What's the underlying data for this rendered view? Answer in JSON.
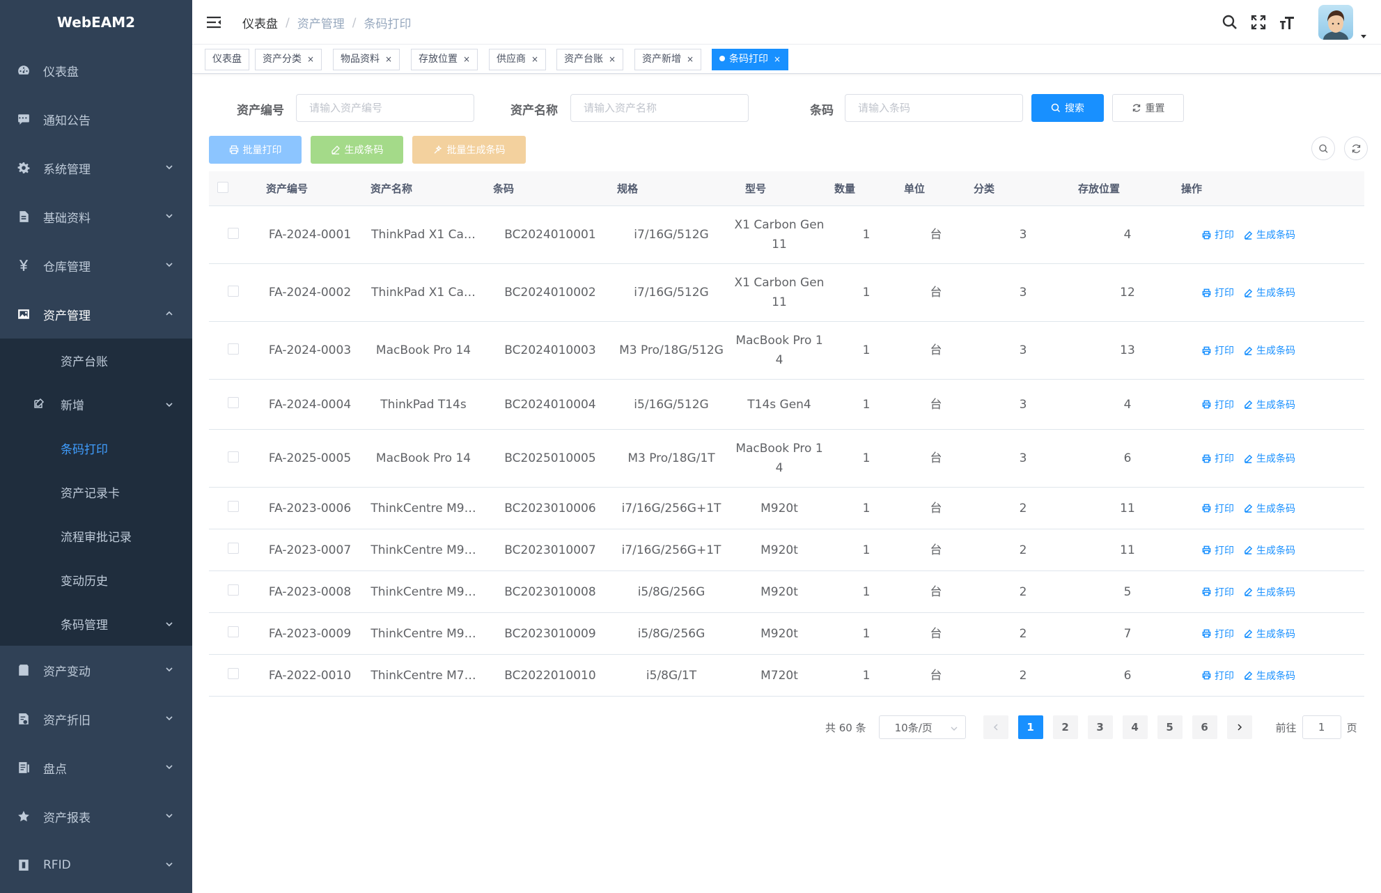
{
  "app": {
    "title": "WebEAM2"
  },
  "sidebar": {
    "items": [
      {
        "label": "仪表盘",
        "icon": "dashboard-icon"
      },
      {
        "label": "通知公告",
        "icon": "message-icon"
      },
      {
        "label": "系统管理",
        "icon": "gear-icon"
      },
      {
        "label": "基础资料",
        "icon": "document-icon"
      },
      {
        "label": "仓库管理",
        "icon": "yen-icon"
      },
      {
        "label": "资产管理",
        "icon": "image-icon"
      }
    ],
    "asset_sub": [
      {
        "label": "资产台账"
      },
      {
        "label": "新增"
      },
      {
        "label": "条码打印"
      },
      {
        "label": "资产记录卡"
      },
      {
        "label": "流程审批记录"
      },
      {
        "label": "变动历史"
      },
      {
        "label": "条码管理"
      }
    ],
    "items_after": [
      {
        "label": "资产变动",
        "icon": "clipboard-icon"
      },
      {
        "label": "资产折旧",
        "icon": "depreciation-icon"
      },
      {
        "label": "盘点",
        "icon": "inventory-icon"
      },
      {
        "label": "资产报表",
        "icon": "star-icon"
      },
      {
        "label": "RFID",
        "icon": "rfid-icon"
      }
    ]
  },
  "navbar": {
    "breadcrumb": [
      "仪表盘",
      "资产管理",
      "条码打印"
    ]
  },
  "tags": [
    "仪表盘",
    "资产分类",
    "物品资料",
    "存放位置",
    "供应商",
    "资产台账",
    "资产新增",
    "条码打印"
  ],
  "search": {
    "asset_no_label": "资产编号",
    "asset_no_placeholder": "请输入资产编号",
    "asset_name_label": "资产名称",
    "asset_name_placeholder": "请输入资产名称",
    "barcode_label": "条码",
    "barcode_placeholder": "请输入条码",
    "search_btn": "搜索",
    "reset_btn": "重置"
  },
  "toolbar": {
    "batch_print": "批量打印",
    "gen_barcode": "生成条码",
    "batch_gen_barcode": "批量生成条码"
  },
  "table": {
    "columns": [
      "资产编号",
      "资产名称",
      "条码",
      "规格",
      "型号",
      "数量",
      "单位",
      "分类",
      "存放位置",
      "操作"
    ],
    "op_print": "打印",
    "op_generate": "生成条码",
    "rows": [
      {
        "no": "FA-2024-0001",
        "name": "ThinkPad X1 Ca…",
        "barcode": "BC2024010001",
        "spec": "i7/16G/512G",
        "model": [
          "X1 Carbon Gen",
          "11"
        ],
        "qty": "1",
        "unit": "台",
        "cat": "3",
        "loc": "4"
      },
      {
        "no": "FA-2024-0002",
        "name": "ThinkPad X1 Ca…",
        "barcode": "BC2024010002",
        "spec": "i7/16G/512G",
        "model": [
          "X1 Carbon Gen",
          "11"
        ],
        "qty": "1",
        "unit": "台",
        "cat": "3",
        "loc": "12"
      },
      {
        "no": "FA-2024-0003",
        "name": "MacBook Pro 14",
        "barcode": "BC2024010003",
        "spec": "M3 Pro/18G/512G",
        "model": [
          "MacBook Pro 1",
          "4"
        ],
        "qty": "1",
        "unit": "台",
        "cat": "3",
        "loc": "13"
      },
      {
        "no": "FA-2024-0004",
        "name": "ThinkPad T14s",
        "barcode": "BC2024010004",
        "spec": "i5/16G/512G",
        "model": [
          "T14s Gen4"
        ],
        "qty": "1",
        "unit": "台",
        "cat": "3",
        "loc": "4"
      },
      {
        "no": "FA-2025-0005",
        "name": "MacBook Pro 14",
        "barcode": "BC2025010005",
        "spec": "M3 Pro/18G/1T",
        "model": [
          "MacBook Pro 1",
          "4"
        ],
        "qty": "1",
        "unit": "台",
        "cat": "3",
        "loc": "6"
      },
      {
        "no": "FA-2023-0006",
        "name": "ThinkCentre M9…",
        "barcode": "BC2023010006",
        "spec": "i7/16G/256G+1T",
        "model": [
          "M920t"
        ],
        "qty": "1",
        "unit": "台",
        "cat": "2",
        "loc": "11"
      },
      {
        "no": "FA-2023-0007",
        "name": "ThinkCentre M9…",
        "barcode": "BC2023010007",
        "spec": "i7/16G/256G+1T",
        "model": [
          "M920t"
        ],
        "qty": "1",
        "unit": "台",
        "cat": "2",
        "loc": "11"
      },
      {
        "no": "FA-2023-0008",
        "name": "ThinkCentre M9…",
        "barcode": "BC2023010008",
        "spec": "i5/8G/256G",
        "model": [
          "M920t"
        ],
        "qty": "1",
        "unit": "台",
        "cat": "2",
        "loc": "5"
      },
      {
        "no": "FA-2023-0009",
        "name": "ThinkCentre M9…",
        "barcode": "BC2023010009",
        "spec": "i5/8G/256G",
        "model": [
          "M920t"
        ],
        "qty": "1",
        "unit": "台",
        "cat": "2",
        "loc": "7"
      },
      {
        "no": "FA-2022-0010",
        "name": "ThinkCentre M7…",
        "barcode": "BC2022010010",
        "spec": "i5/8G/1T",
        "model": [
          "M720t"
        ],
        "qty": "1",
        "unit": "台",
        "cat": "2",
        "loc": "6"
      }
    ]
  },
  "pagination": {
    "total": "共 60 条",
    "page_size": "10条/页",
    "pages": [
      "1",
      "2",
      "3",
      "4",
      "5",
      "6"
    ],
    "current": "1",
    "goto_label": "前往",
    "goto_value": "1",
    "page_suffix": "页"
  },
  "colors": {
    "primary": "#1890ff",
    "sidebar_bg": "#304156",
    "sidebar_sub_bg": "#1f2d3d",
    "active_text": "#409eff"
  }
}
